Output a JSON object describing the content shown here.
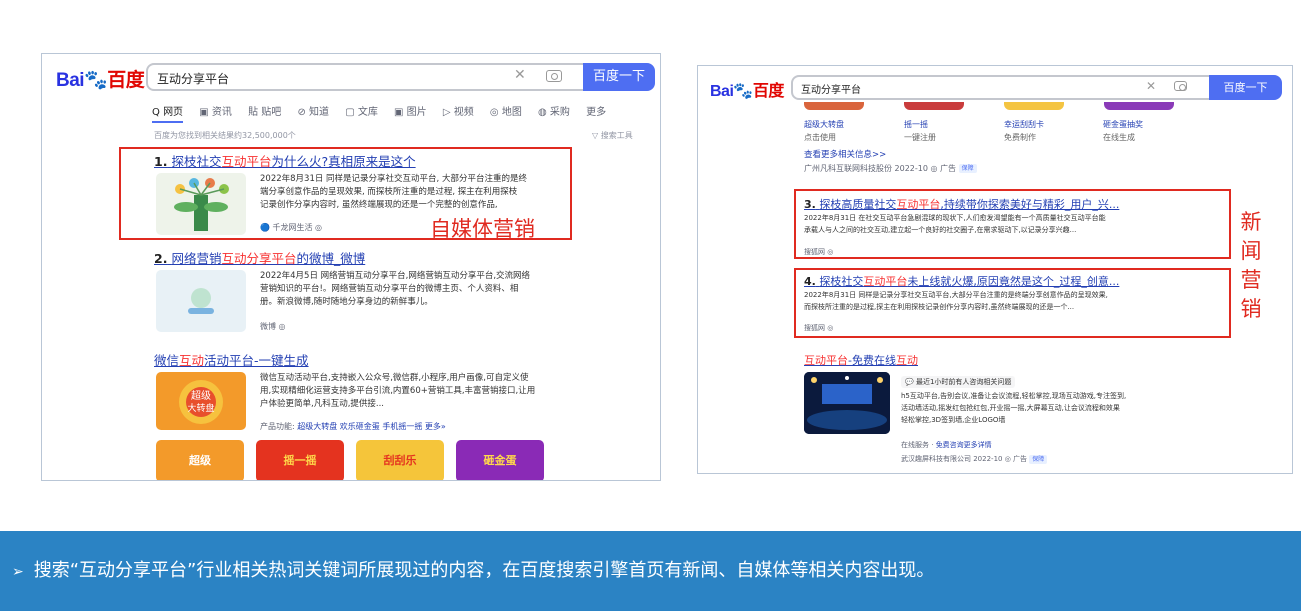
{
  "left": {
    "logo": {
      "bai": "Bai",
      "du": "du",
      "baidu": "百度"
    },
    "search_value": "互动分享平台",
    "search_button": "百度一下",
    "tabs": [
      "网页",
      "资讯",
      "贴吧",
      "知道",
      "文库",
      "图片",
      "视频",
      "地图",
      "采购",
      "更多"
    ],
    "result_count": "百度为您找到相关结果约32,500,000个",
    "search_tools": "搜索工具",
    "r1": {
      "title_num": "1.",
      "title_a": "探枝社交",
      "title_em": "互动平台",
      "title_b": "为什么火?真相原来是这个",
      "text": [
        "2022年8月31日 同样是记录分享社交互动平台, 大部分平台注重的是终",
        "端分享创意作品的呈现效果, 而探枝所注重的是过程, 探主在利用探枝",
        "记录创作分享内容时, 虽然终端展现的还是一个完整的创意作品,"
      ],
      "source": "千龙网生活"
    },
    "r2": {
      "title_num": "2.",
      "title_a": "网络营销",
      "title_em": "互动分享平台",
      "title_b": "的微博_微博",
      "text": [
        "2022年4月5日 网络营销互动分享平台,网络营销互动分享平台,交流网络",
        "营销知识的平台!。网络营销互动分享平台的微博主页、个人资料、相",
        "册。新浪微博,随时随地分享身边的新鲜事儿。"
      ],
      "source": "微博"
    },
    "r3": {
      "title_a": "微信",
      "title_em": "互动",
      "title_b": "活动平台-一键生成",
      "text": [
        "微信互动活动平台,支持嵌入公众号,微信群,小程序,用户画像,可自定义使",
        "用,实现精细化运营支持多平台引流,内置60+营销工具,丰富营销接口,让用",
        "户体验更简单,凡科互动,提供接..."
      ],
      "features_label": "产品功能:",
      "features": [
        "超级大转盘",
        "欢乐砸金蛋",
        "手机摇一摇",
        "更多»"
      ]
    },
    "label": "自媒体营销",
    "thumb_texts": [
      "超级",
      "大转盘",
      "摇一摇",
      "刮刮乐",
      "砸金蛋"
    ]
  },
  "right": {
    "search_value": "互动分享平台",
    "search_button": "百度一下",
    "icons_row": [
      "超级大转盘",
      "摇一摇",
      "幸运刮刮卡",
      "砸金蛋抽奖"
    ],
    "icons_sub": [
      "点击使用",
      "一键注册",
      "免费制作",
      "在线生成"
    ],
    "more_info": "查看更多相关信息>>",
    "ad_source": "广州凡科互联网科技股份 2022-10",
    "ad_label": "广告",
    "verified": "保障",
    "r3": {
      "title_num": "3.",
      "title_a": "探枝高质量社交",
      "title_em": "互动平台",
      "title_b": ",持续带你探索美好与精彩_用户_兴...",
      "text": [
        "2022年8月31日 在社交互动平台急剧混球的现状下,人们愈发渴望能有一个高质量社交互动平台能",
        "承载人与人之间的社交互动,建立起一个良好的社交圈子,在需求驱动下,以记录分享兴趣..."
      ],
      "source": "搜狐网"
    },
    "r4": {
      "title_num": "4.",
      "title_a": "探枝社交",
      "title_em": "互动平台",
      "title_b": "未上线就火爆,原因竟然是这个_过程_创意...",
      "text": [
        "2022年8月31日 同样是记录分享社交互动平台,大部分平台注重的是终端分享创意作品的呈现效果,",
        "而探枝所注重的是过程,探主在利用探枝记录创作分享内容时,虽然终端展现的还是一个..."
      ],
      "source": "搜狐网"
    },
    "r5": {
      "title_a": "互动平台",
      "title_b": "-免费在线",
      "title_em": "互动",
      "recent": "最近1小时前有人咨询相关问题",
      "text": [
        "h5互动平台,告别会议,准备让会议流程,轻松掌控,现场互动游戏,专注签到,",
        "活动墙活动,摇发红包抢红包,开业摇一摇,大屏幕互动,让会议流程和效果",
        "轻松掌控,3D签到墙,企业LOGO墙"
      ],
      "service": "在线服务",
      "service_link": "免费咨询更多详情",
      "company": "武汉趣屏科技有限公司 2022-10"
    },
    "label_chars": [
      "新",
      "闻",
      "营",
      "销"
    ]
  },
  "footer": {
    "bullet": "➢",
    "text": "搜索“互动分享平台”行业相关热词关键词所展现过的内容，在百度搜索引擎首页有新闻、自媒体等相关内容出现。"
  }
}
